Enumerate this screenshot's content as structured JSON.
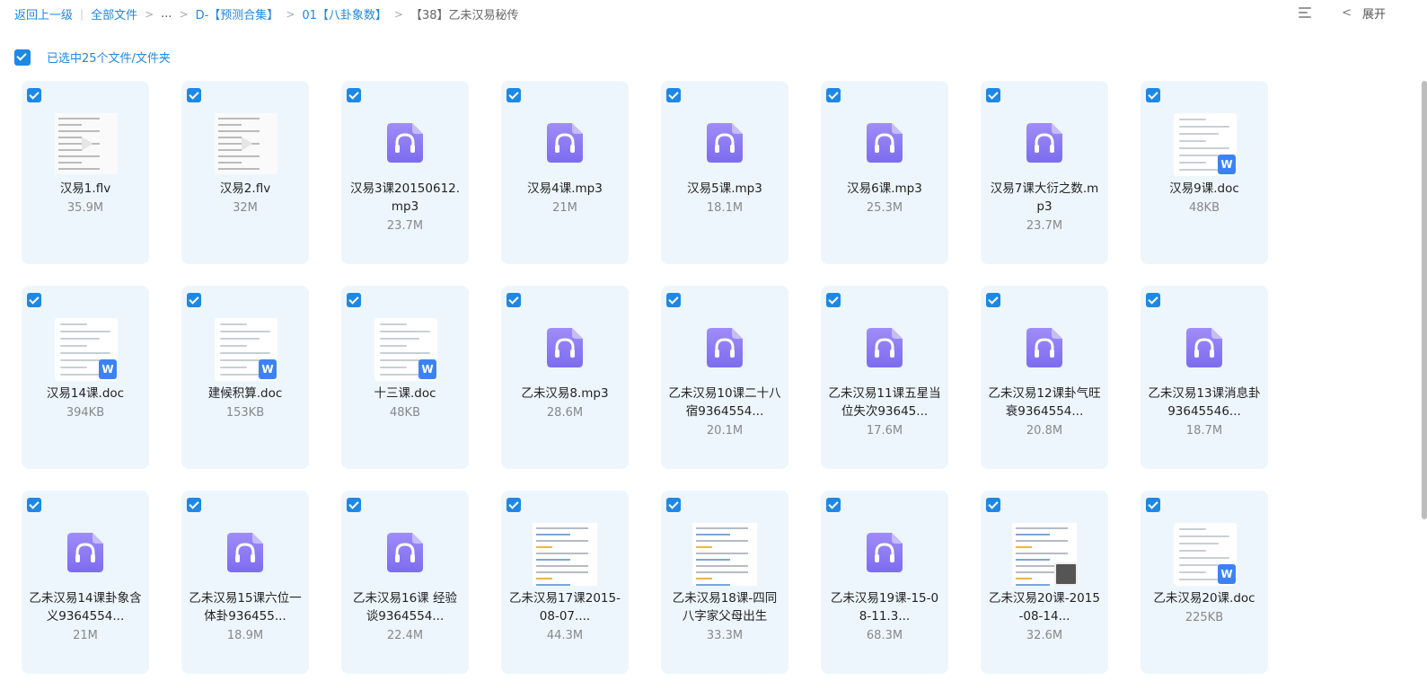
{
  "breadcrumb": {
    "back": "返回上一级",
    "items": [
      "全部文件",
      "...",
      "D-【预测合集】",
      "01【八卦象数】"
    ],
    "current": "【38】乙未汉易秘传"
  },
  "toolbar": {
    "expand_label": "展开"
  },
  "selection": {
    "text": "已选中25个文件/文件夹"
  },
  "files": [
    {
      "name": "汉易1.flv",
      "size": "35.9M",
      "type": "video"
    },
    {
      "name": "汉易2.flv",
      "size": "32M",
      "type": "video"
    },
    {
      "name": "汉易3课20150612.mp3",
      "size": "23.7M",
      "type": "audio"
    },
    {
      "name": "汉易4课.mp3",
      "size": "21M",
      "type": "audio"
    },
    {
      "name": "汉易5课.mp3",
      "size": "18.1M",
      "type": "audio"
    },
    {
      "name": "汉易6课.mp3",
      "size": "25.3M",
      "type": "audio"
    },
    {
      "name": "汉易7课大衍之数.mp3",
      "size": "23.7M",
      "type": "audio"
    },
    {
      "name": "汉易9课.doc",
      "size": "48KB",
      "type": "doc"
    },
    {
      "name": "汉易14课.doc",
      "size": "394KB",
      "type": "doc"
    },
    {
      "name": "建候积算.doc",
      "size": "153KB",
      "type": "doc"
    },
    {
      "name": "十三课.doc",
      "size": "48KB",
      "type": "doc"
    },
    {
      "name": "乙未汉易8.mp3",
      "size": "28.6M",
      "type": "audio"
    },
    {
      "name": "乙未汉易10课二十八宿9364554...",
      "size": "20.1M",
      "type": "audio"
    },
    {
      "name": "乙未汉易11课五星当位失次93645...",
      "size": "17.6M",
      "type": "audio"
    },
    {
      "name": "乙未汉易12课卦气旺衰9364554...",
      "size": "20.8M",
      "type": "audio"
    },
    {
      "name": "乙未汉易13课消息卦93645546...",
      "size": "18.7M",
      "type": "audio"
    },
    {
      "name": "乙未汉易14课卦象含义9364554...",
      "size": "21M",
      "type": "audio"
    },
    {
      "name": "乙未汉易15课六位一体卦936455...",
      "size": "18.9M",
      "type": "audio"
    },
    {
      "name": "乙未汉易16课 经验谈9364554...",
      "size": "22.4M",
      "type": "audio"
    },
    {
      "name": "乙未汉易17课2015-08-07....",
      "size": "44.3M",
      "type": "image"
    },
    {
      "name": "乙未汉易18课-四同八字家父母出生",
      "size": "33.3M",
      "type": "image"
    },
    {
      "name": "乙未汉易19课-15-08-11.3...",
      "size": "68.3M",
      "type": "audio"
    },
    {
      "name": "乙未汉易20课-2015-08-14...",
      "size": "32.6M",
      "type": "image2"
    },
    {
      "name": "乙未汉易20课.doc",
      "size": "225KB",
      "type": "doc"
    }
  ],
  "icons": {
    "audio": "headphones-file-icon",
    "doc": "word-doc-icon",
    "video": "video-thumbnail",
    "image": "image-thumbnail",
    "check": "checkbox-checked-icon"
  },
  "colors": {
    "accent": "#1e88e5",
    "card_bg": "#eef6fd",
    "audio_icon": "#8b7cf6"
  }
}
